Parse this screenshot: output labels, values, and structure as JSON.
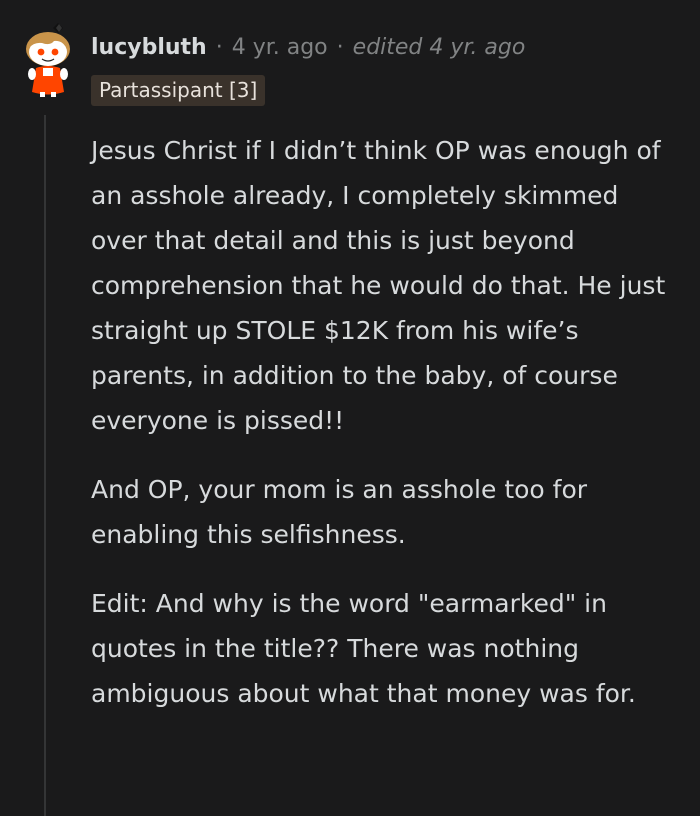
{
  "comment": {
    "author": "lucybluth",
    "separator": "·",
    "time": "4 yr. ago",
    "edited": "edited 4 yr. ago",
    "flair": "Partassipant [3]",
    "paragraphs": [
      "Jesus Christ if I didn’t think OP was enough of an asshole already, I completely skimmed over that detail and this is just beyond comprehension that he would do that. He just straight up STOLE $12K from his wife’s parents, in addition to the baby, of course everyone is pissed!!",
      "And OP, your mom is an asshole too for enabling this selfishness.",
      "Edit: And why is the word \"earmarked\" in quotes in the title?? There was nothing ambiguous about what that money was for."
    ],
    "avatar_icon": "snoo-avatar-icon",
    "flair_color": "#3a322b",
    "thread_line_color": "#343536"
  }
}
